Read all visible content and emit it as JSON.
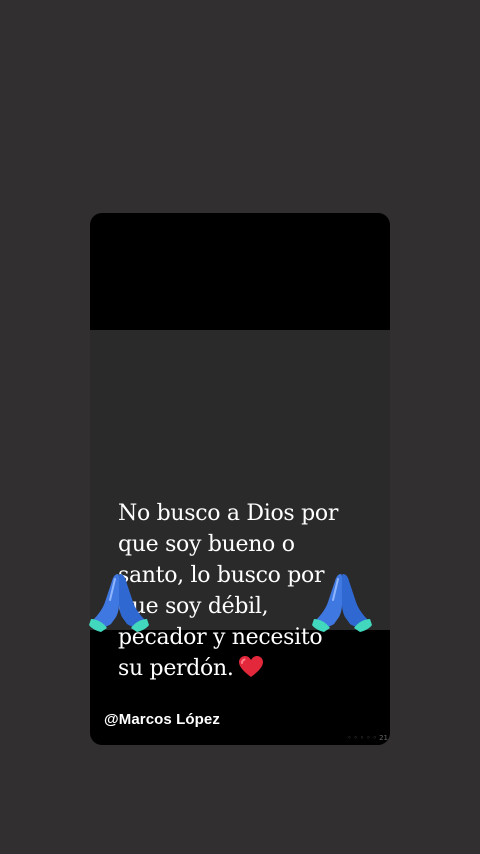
{
  "story": {
    "quote_lines": [
      "No busco a Dios por",
      "que soy bueno o",
      "santo, lo busco por",
      "que soy débil,",
      "pecador y necesito",
      "su perdón."
    ],
    "heart_icon": "heart-icon",
    "prayer_icon": "folded-hands-icon",
    "colors": {
      "background": "#312f30",
      "card": "#000000",
      "image_panel": "#2b2a2b",
      "text": "#ffffff",
      "heart": "#e3283b",
      "hands_blue": "#3f78e0",
      "cuffs_mint": "#41d8bd"
    },
    "username": "@Marcos López"
  }
}
